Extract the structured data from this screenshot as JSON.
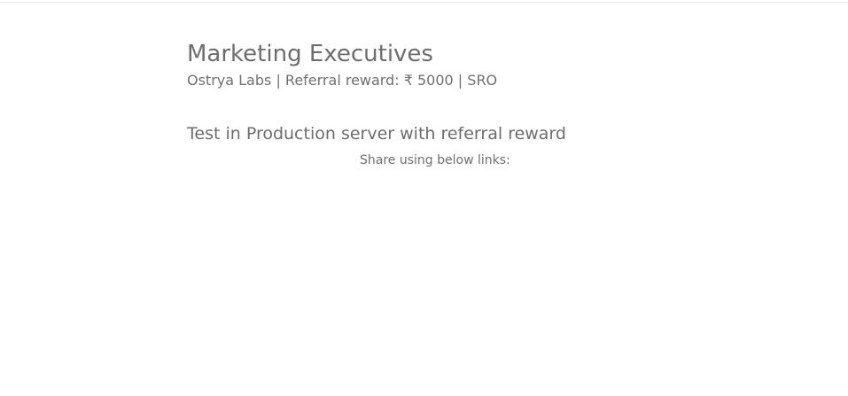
{
  "job": {
    "title": "Marketing Executives",
    "meta": "Ostrya Labs | Referral reward: ₹ 5000 | SRO",
    "description": "Test in Production server with referral reward"
  },
  "share": {
    "label": "Share using below links:"
  }
}
